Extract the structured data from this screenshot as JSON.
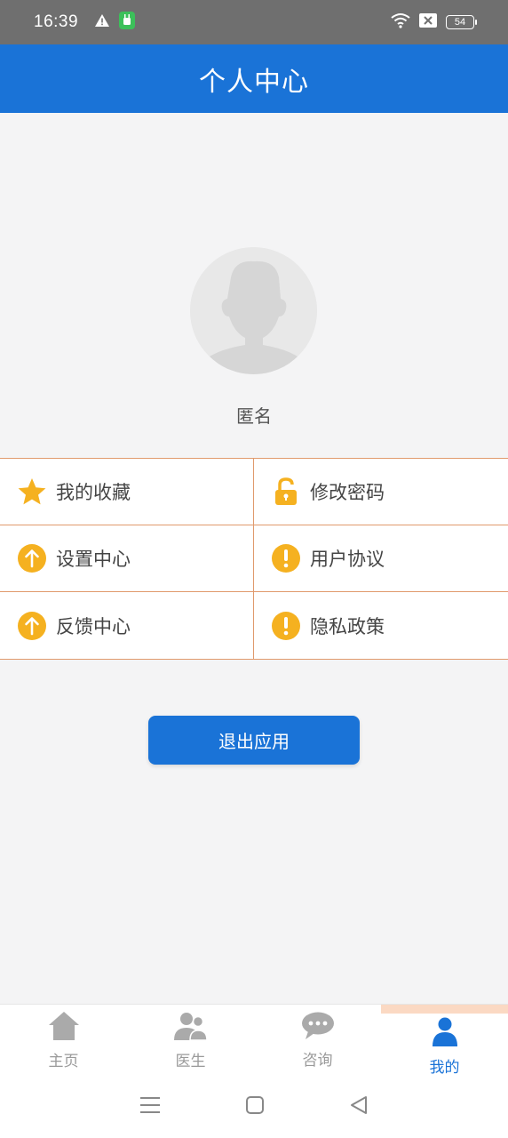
{
  "status_bar": {
    "time": "16:39",
    "battery": "54",
    "icons": [
      "warning-icon",
      "android-notification-icon",
      "wifi-icon",
      "sim-off-icon",
      "battery-icon"
    ]
  },
  "header": {
    "title": "个人中心"
  },
  "profile": {
    "name": "匿名",
    "avatar_icon": "default-avatar-icon"
  },
  "menu": {
    "items": [
      {
        "label": "我的收藏",
        "icon": "star-icon"
      },
      {
        "label": "修改密码",
        "icon": "unlock-icon"
      },
      {
        "label": "设置中心",
        "icon": "arrow-up-icon"
      },
      {
        "label": "用户协议",
        "icon": "exclamation-icon"
      },
      {
        "label": "反馈中心",
        "icon": "arrow-up-icon"
      },
      {
        "label": "隐私政策",
        "icon": "exclamation-icon"
      }
    ]
  },
  "exit_button": {
    "label": "退出应用"
  },
  "bottom_nav": {
    "items": [
      {
        "label": "主页",
        "icon": "home-icon"
      },
      {
        "label": "医生",
        "icon": "doctors-icon"
      },
      {
        "label": "咨询",
        "icon": "chat-bubble-icon"
      },
      {
        "label": "我的",
        "icon": "person-icon",
        "active": true
      }
    ]
  },
  "colors": {
    "primary": "#1a73d7",
    "icon_yellow": "#f5b120",
    "grid_border": "#e09a6d",
    "nav_active_bg": "#fbd9c3",
    "nav_inactive": "#9a9a9a"
  }
}
